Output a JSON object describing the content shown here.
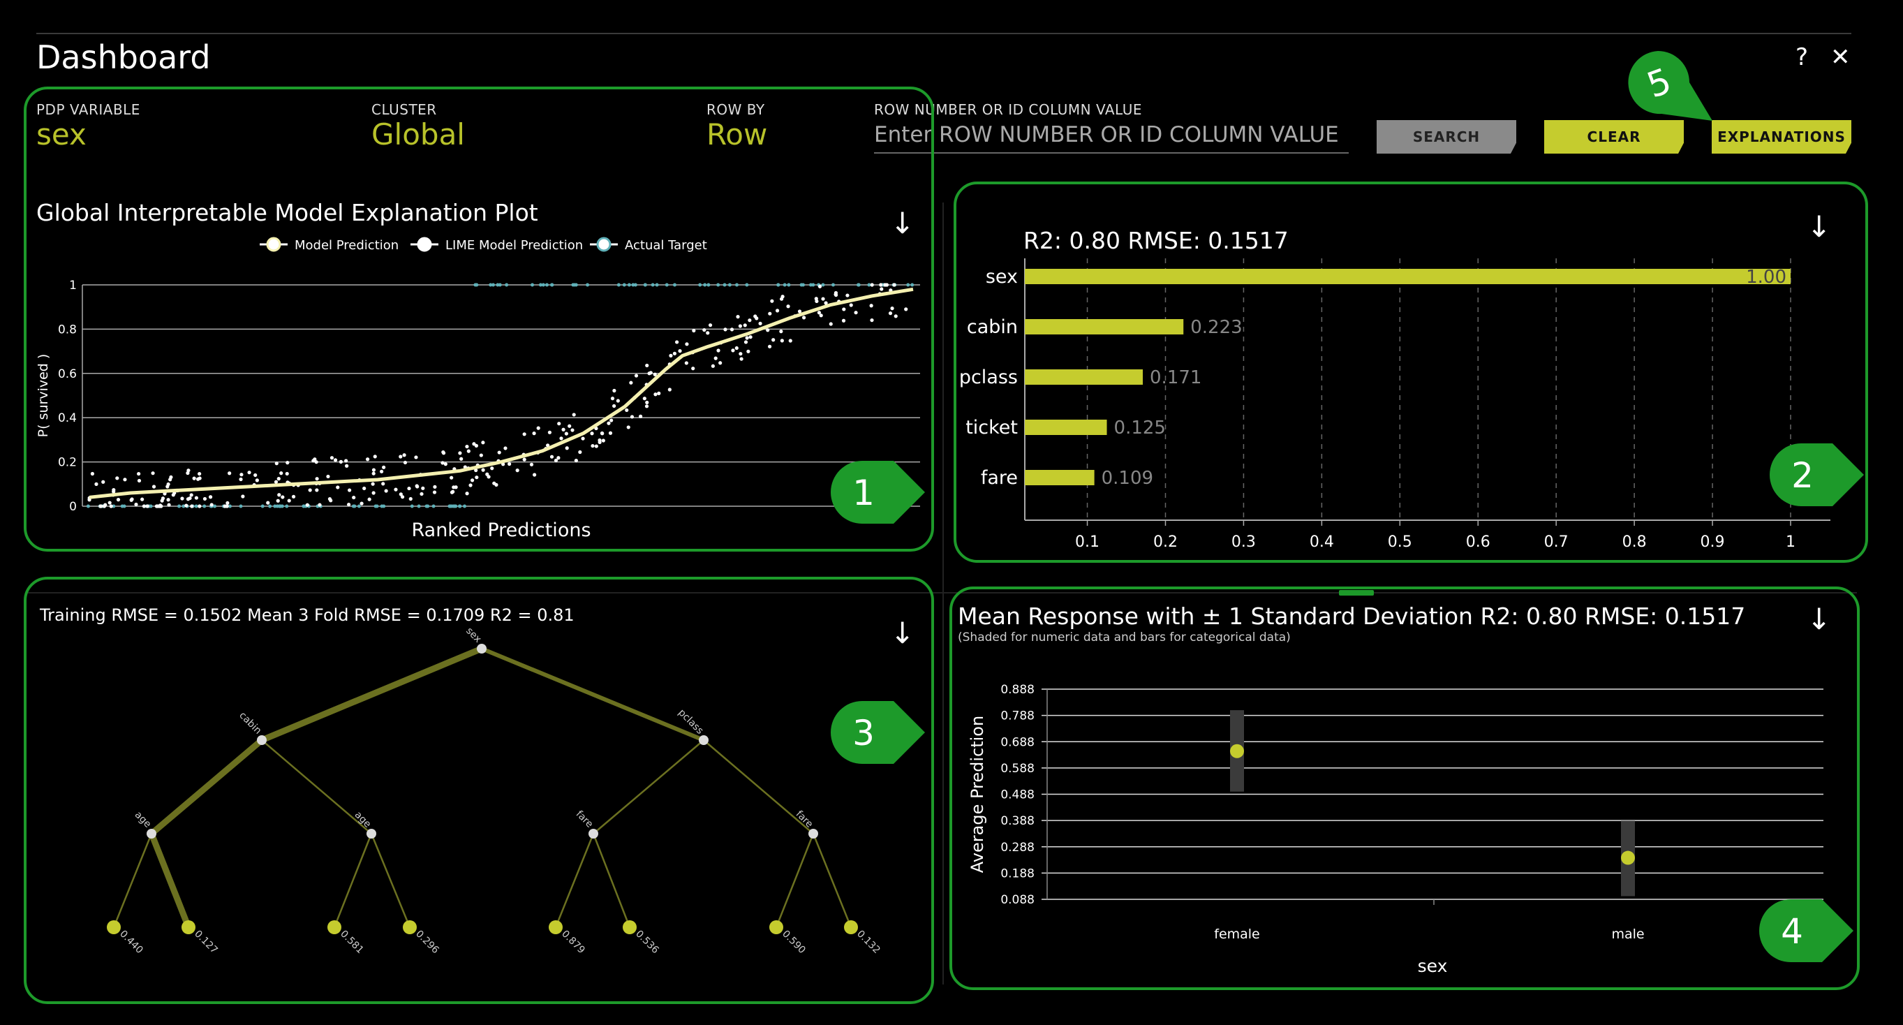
{
  "app": {
    "title": "Dashboard"
  },
  "header_icons": {
    "help": "?",
    "close": "✕"
  },
  "controls": {
    "pdp_variable": {
      "label": "PDP VARIABLE",
      "value": "sex"
    },
    "cluster": {
      "label": "CLUSTER",
      "value": "Global"
    },
    "row_by": {
      "label": "ROW BY",
      "value": "Row"
    },
    "row_search": {
      "label": "ROW NUMBER OR ID COLUMN VALUE",
      "placeholder": "Enter ROW NUMBER OR ID COLUMN VALUE"
    },
    "buttons": {
      "search": "SEARCH",
      "clear": "CLEAR",
      "explanations": "EXPLANATIONS"
    }
  },
  "download_icon": "↓",
  "markers": [
    "1",
    "2",
    "3",
    "4",
    "5"
  ],
  "colors": {
    "accent_lime": "#c5cc2e",
    "callout_green": "#1d9a2a",
    "actual_target": "#5fb0b8",
    "button_gray": "#8a8a8a"
  },
  "chart_data": [
    {
      "type": "scatter",
      "title": "Global Interpretable Model Explanation Plot",
      "legend": [
        "Model Prediction",
        "LIME Model Prediction",
        "Actual Target"
      ],
      "legend_position": "top",
      "xlabel": "Ranked Predictions",
      "ylabel": "P( survived )",
      "ylim": [
        0,
        1
      ],
      "yticks": [
        "0",
        "0.2",
        "0.4",
        "0.6",
        "0.8",
        "1"
      ],
      "series": [
        {
          "name": "Model Prediction",
          "x": [
            0,
            5,
            10,
            15,
            20,
            25,
            30,
            35,
            40,
            45,
            50,
            55,
            60,
            65,
            70,
            72,
            75,
            80,
            85,
            90,
            95,
            100
          ],
          "y": [
            0.04,
            0.06,
            0.07,
            0.08,
            0.09,
            0.1,
            0.11,
            0.12,
            0.14,
            0.16,
            0.2,
            0.25,
            0.33,
            0.45,
            0.62,
            0.68,
            0.72,
            0.78,
            0.85,
            0.91,
            0.95,
            0.98
          ]
        }
      ]
    },
    {
      "type": "bar",
      "title": "R2: 0.80 RMSE: 0.1517",
      "categories": [
        "sex",
        "cabin",
        "pclass",
        "ticket",
        "fare"
      ],
      "values": [
        1.0,
        0.223,
        0.171,
        0.125,
        0.109
      ],
      "data_labels": [
        "1.00",
        "0.223",
        "0.171",
        "0.125",
        "0.109"
      ],
      "xticks": [
        "0.1",
        "0.2",
        "0.3",
        "0.4",
        "0.5",
        "0.6",
        "0.7",
        "0.8",
        "0.9",
        "1"
      ],
      "xlim": [
        0.02,
        1.0
      ],
      "grid": true
    },
    {
      "type": "tree",
      "title": "Training RMSE = 0.1502 Mean 3 Fold RMSE = 0.1709 R2 = 0.81",
      "levels": [
        [
          "sex"
        ],
        [
          "cabin",
          "pclass"
        ],
        [
          "age",
          "age",
          "fare",
          "fare"
        ],
        [
          "0.440",
          "0.127",
          "0.581",
          "0.296",
          "0.879",
          "0.536",
          "0.590",
          "0.132"
        ]
      ],
      "highlight_path": [
        "sex",
        "cabin",
        "age",
        "0.127"
      ]
    },
    {
      "type": "scatter",
      "title": "Mean Response with ± 1 Standard Deviation R2: 0.80 RMSE: 0.1517",
      "subtitle": "(Shaded for numeric data and bars for categorical data)",
      "categories": [
        "female",
        "male"
      ],
      "values": [
        0.652,
        0.246
      ],
      "sd_low": [
        0.498,
        0.1
      ],
      "sd_high": [
        0.808,
        0.387
      ],
      "xlabel": "sex",
      "ylabel": "Average Prediction",
      "ylim": [
        0.088,
        0.888
      ],
      "yticks": [
        "0.888",
        "0.788",
        "0.688",
        "0.588",
        "0.488",
        "0.388",
        "0.288",
        "0.188",
        "0.088"
      ]
    }
  ]
}
